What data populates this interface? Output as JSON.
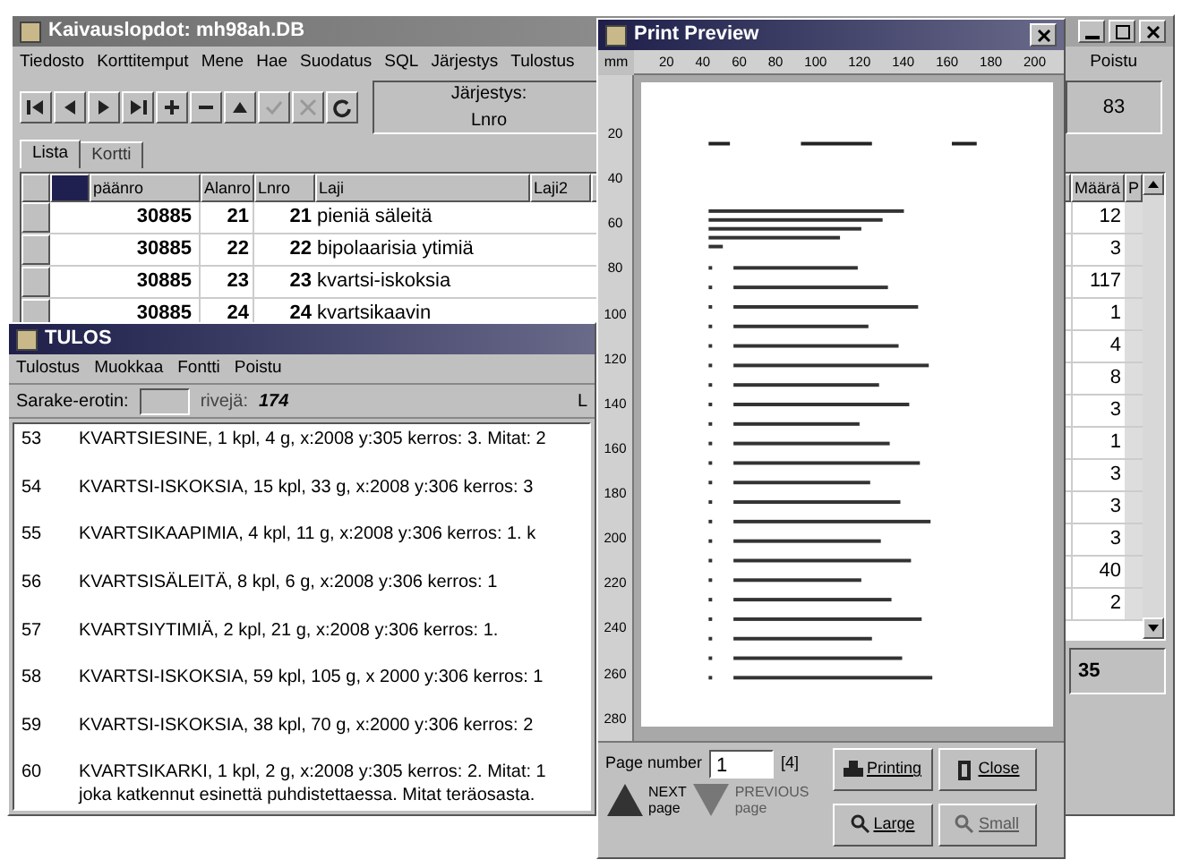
{
  "main_window": {
    "title": "Kaivauslopdot: mh98ah.DB",
    "menu": [
      "Tiedosto",
      "Korttitemput",
      "Mene",
      "Hae",
      "Suodatus",
      "SQL",
      "Järjestys",
      "Tulostus",
      "Poistu"
    ],
    "sort_label": "Järjestys:",
    "sort_value": "Lnro",
    "count": "83",
    "tabs": [
      {
        "label": "Lista",
        "selected": true
      },
      {
        "label": "Kortti",
        "selected": false
      }
    ],
    "columns": [
      "päänro",
      "Alanro",
      "Lnro",
      "Laji",
      "Laji2",
      "Määrä",
      "P"
    ],
    "rows": [
      {
        "paanro": "30885",
        "alanro": "21",
        "lnro": "21",
        "laji": "pieniä säleitä",
        "maara": "12"
      },
      {
        "paanro": "30885",
        "alanro": "22",
        "lnro": "22",
        "laji": "bipolaarisia ytimiä",
        "maara": "3"
      },
      {
        "paanro": "30885",
        "alanro": "23",
        "lnro": "23",
        "laji": "kvartsi-iskoksia",
        "maara": "117"
      },
      {
        "paanro": "30885",
        "alanro": "24",
        "lnro": "24",
        "laji": "kvartsikaavin",
        "maara": "1"
      },
      {
        "maara": "4"
      },
      {
        "maara": "8"
      },
      {
        "maara": "3"
      },
      {
        "maara": "1"
      },
      {
        "maara": "3"
      },
      {
        "maara": "3"
      },
      {
        "maara": "3"
      },
      {
        "maara": "40"
      },
      {
        "maara": "2"
      }
    ],
    "status_value": "35"
  },
  "tulos_window": {
    "title": "TULOS",
    "menu": [
      "Tulostus",
      "Muokkaa",
      "Fontti",
      "Poistu"
    ],
    "separator_label": "Sarake-erotin:",
    "rows_label": "rivejä:",
    "rows_value": "174",
    "cut_label": "L",
    "lines": [
      {
        "no": "53",
        "text": "KVARTSIESINE, 1 kpl, 4 g, x:2008 y:305 kerros: 3. Mitat: 2"
      },
      {
        "no": "54",
        "text": "KVARTSI-ISKOKSIA, 15 kpl, 33 g, x:2008 y:306 kerros: 3"
      },
      {
        "no": "55",
        "text": "KVARTSIKAAPIMIA, 4 kpl, 11 g, x:2008 y:306 kerros: 1. k"
      },
      {
        "no": "56",
        "text": "KVARTSISÄLEITÄ, 8 kpl, 6 g, x:2008 y:306 kerros: 1"
      },
      {
        "no": "57",
        "text": "KVARTSIYTIMIÄ, 2 kpl, 21 g, x:2008 y:306 kerros: 1."
      },
      {
        "no": "58",
        "text": "KVARTSI-ISKOKSIA, 59 kpl, 105 g, x 2000 y:306 kerros: 1"
      },
      {
        "no": "59",
        "text": "KVARTSI-ISKOKSIA, 38 kpl, 70 g, x:2000 y:306 kerros: 2"
      },
      {
        "no": "60",
        "text": "KVARTSIKARKI, 1 kpl, 2 g, x:2008 y:305 kerros: 2. Mitat: 1\njoka katkennut esinettä puhdistettaessa. Mitat teräosasta."
      }
    ]
  },
  "preview_window": {
    "title": "Print Preview",
    "ruler_unit": "mm",
    "top_ruler": [
      "20",
      "40",
      "60",
      "80",
      "100",
      "120",
      "140",
      "160",
      "180",
      "200"
    ],
    "left_ruler": [
      "20",
      "40",
      "60",
      "80",
      "100",
      "120",
      "140",
      "160",
      "180",
      "200",
      "220",
      "240",
      "260",
      "280"
    ],
    "page_label": "Page number",
    "page_value": "1",
    "page_total": "[4]",
    "buttons": [
      {
        "kind": "print",
        "label": "Printing",
        "disabled": false
      },
      {
        "kind": "close",
        "label": "Close",
        "disabled": false
      },
      {
        "kind": "large",
        "label": "Large",
        "disabled": false
      },
      {
        "kind": "small",
        "label": "Small",
        "disabled": true
      }
    ],
    "nav": [
      {
        "kind": "next",
        "label": "NEXT\npage",
        "disabled": false
      },
      {
        "kind": "previous",
        "label": "PREVIOUS\npage",
        "disabled": true
      }
    ]
  }
}
